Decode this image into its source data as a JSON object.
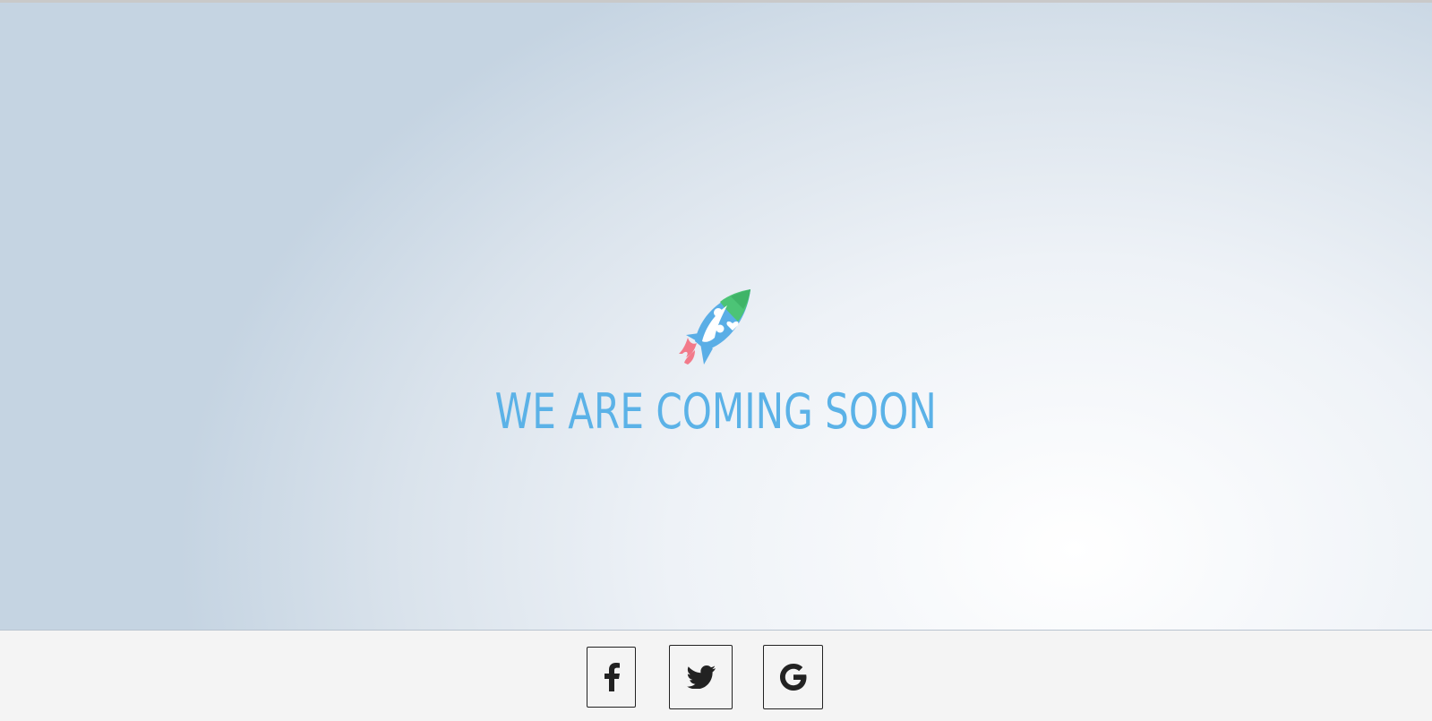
{
  "hero": {
    "heading": "WE ARE COMING SOON",
    "logo_icon": "rocket-logo-icon"
  },
  "footer": {
    "social": [
      {
        "name": "facebook",
        "icon": "facebook-icon"
      },
      {
        "name": "twitter",
        "icon": "twitter-icon"
      },
      {
        "name": "google",
        "icon": "google-icon"
      }
    ]
  },
  "colors": {
    "heading": "#5bb2e7",
    "rocket_body": "#5aaee6",
    "rocket_nose": "#4cc476",
    "flame": "#f27a8a",
    "footer_bg": "#f4f4f4"
  }
}
